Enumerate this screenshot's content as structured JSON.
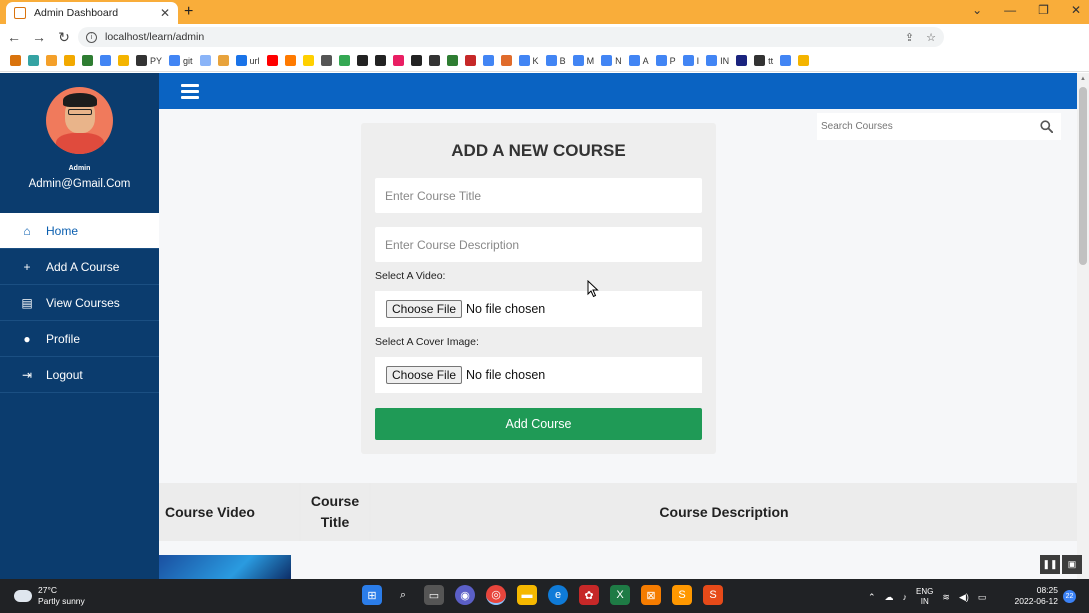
{
  "browser": {
    "tab_title": "Admin Dashboard",
    "tab_close": "✕",
    "new_tab": "+",
    "url": "localhost/learn/admin",
    "window_controls": [
      "⌄",
      "—",
      "❐",
      "✕"
    ],
    "bookmarks": [
      {
        "label": "",
        "color": "#d9730d"
      },
      {
        "label": "",
        "color": "#35a3a3"
      },
      {
        "label": "",
        "color": "#f4a02a"
      },
      {
        "label": "",
        "color": "#f2a900"
      },
      {
        "label": "",
        "color": "#2e7d32"
      },
      {
        "label": "",
        "color": "#4285f4"
      },
      {
        "label": "",
        "color": "#f4b400"
      },
      {
        "label": "PY",
        "color": "#333333"
      },
      {
        "label": "git",
        "color": "#4285f4"
      },
      {
        "label": "",
        "color": "#8ab4f8"
      },
      {
        "label": "",
        "color": "#e8a33c"
      },
      {
        "label": "url",
        "color": "#1a73e8"
      },
      {
        "label": "",
        "color": "#ff0000"
      },
      {
        "label": "",
        "color": "#ff7a00"
      },
      {
        "label": "",
        "color": "#ffd000"
      },
      {
        "label": "",
        "color": "#555555"
      },
      {
        "label": "",
        "color": "#34a853"
      },
      {
        "label": "",
        "color": "#222222"
      },
      {
        "label": "",
        "color": "#222222"
      },
      {
        "label": "",
        "color": "#e91e63"
      },
      {
        "label": "",
        "color": "#222222"
      },
      {
        "label": "",
        "color": "#333333"
      },
      {
        "label": "",
        "color": "#2e7d32"
      },
      {
        "label": "",
        "color": "#c62828"
      },
      {
        "label": "",
        "color": "#4285f4"
      },
      {
        "label": "",
        "color": "#e06b2b"
      },
      {
        "label": "K",
        "color": "#4285f4"
      },
      {
        "label": "B",
        "color": "#4285f4"
      },
      {
        "label": "M",
        "color": "#4285f4"
      },
      {
        "label": "N",
        "color": "#4285f4"
      },
      {
        "label": "A",
        "color": "#4285f4"
      },
      {
        "label": "P",
        "color": "#4285f4"
      },
      {
        "label": "I",
        "color": "#4285f4"
      },
      {
        "label": "IN",
        "color": "#4285f4"
      },
      {
        "label": "",
        "color": "#1a237e"
      },
      {
        "label": "tt",
        "color": "#333333"
      },
      {
        "label": "",
        "color": "#4285f4"
      },
      {
        "label": "",
        "color": "#f4b400"
      }
    ]
  },
  "sidebar": {
    "role": "Admin",
    "email": "Admin@Gmail.Com",
    "items": [
      {
        "label": "Home",
        "icon": "home-icon",
        "glyph": "⌂",
        "active": true
      },
      {
        "label": "Add A Course",
        "icon": "plus-icon",
        "glyph": "+",
        "active": false
      },
      {
        "label": "View Courses",
        "icon": "book-icon",
        "glyph": "▤",
        "active": false
      },
      {
        "label": "Profile",
        "icon": "user-icon",
        "glyph": "●",
        "active": false
      },
      {
        "label": "Logout",
        "icon": "logout-icon",
        "glyph": "⇥",
        "active": false
      }
    ]
  },
  "search": {
    "placeholder": "Search Courses"
  },
  "form": {
    "title": "ADD A NEW COURSE",
    "title_placeholder": "Enter Course Title",
    "description_placeholder": "Enter Course Description",
    "video_label": "Select A Video:",
    "image_label": "Select A Cover Image:",
    "choose_file": "Choose File",
    "no_file": "No file chosen",
    "submit_label": "Add Course",
    "submit_color": "#1f9a56"
  },
  "table": {
    "headers": [
      "Course Video",
      "Course Title",
      "Course Description"
    ]
  },
  "taskbar": {
    "temperature": "27°C",
    "weather": "Partly sunny",
    "lang_line1": "ENG",
    "lang_line2": "IN",
    "time": "08:25",
    "date": "2022-06-12",
    "notifications": "22"
  },
  "colors": {
    "sidebar_bg": "#0b3c6e",
    "topnav_bg": "#0a63c2",
    "tab_bar": "#f9ad3a"
  }
}
